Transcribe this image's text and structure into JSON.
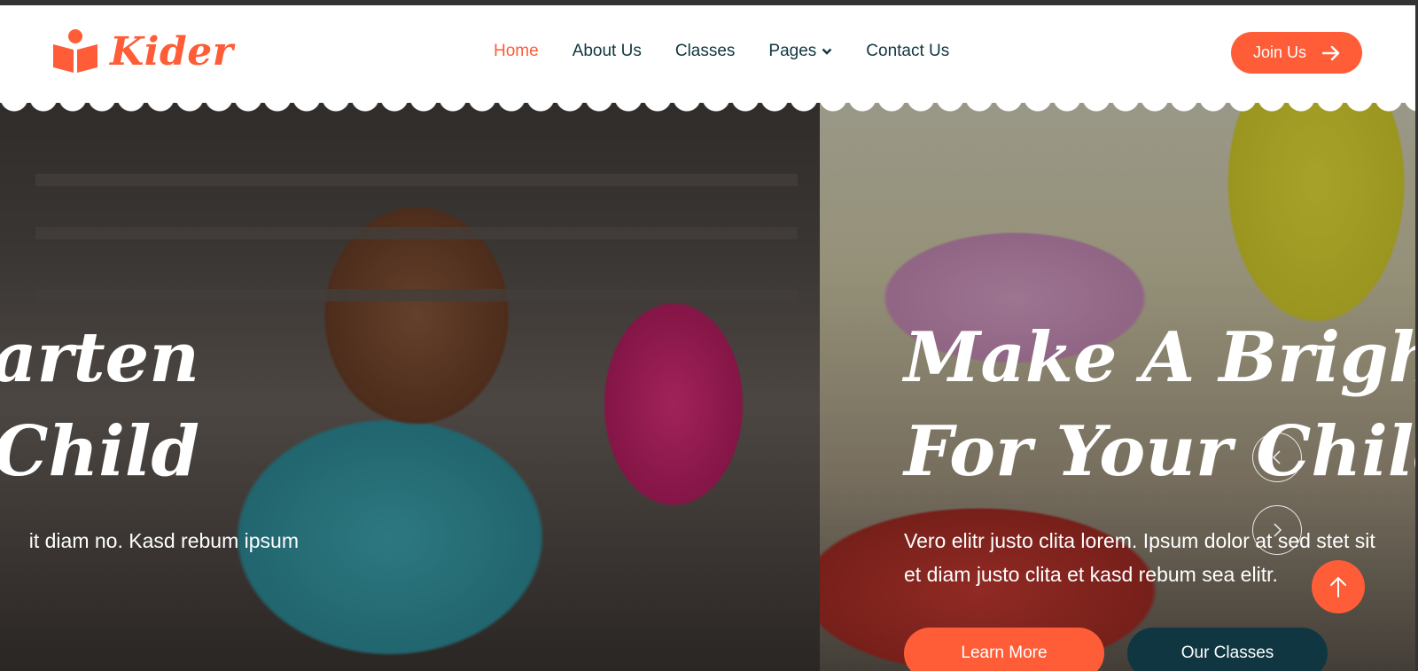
{
  "brand": {
    "name": "Kider",
    "icon": "book-reader-icon"
  },
  "nav": {
    "items": [
      {
        "label": "Home",
        "active": true
      },
      {
        "label": "About Us"
      },
      {
        "label": "Classes"
      },
      {
        "label": "Pages",
        "icon": "chevron-down-icon"
      },
      {
        "label": "Contact Us"
      }
    ]
  },
  "header": {
    "join_label": "Join Us",
    "join_icon": "arrow-right-icon"
  },
  "carousel": {
    "slide_prev": {
      "title_line1": "garten",
      "title_line2": "Child",
      "text_line1": "it diam no. Kasd rebum ipsum"
    },
    "slide_current": {
      "title_line1": "Make A Brighter",
      "title_line2": "For Your Child",
      "text_line1": "Vero elitr justo clita lorem. Ipsum dolor at sed stet sit",
      "text_line2": "et diam justo clita et kasd rebum sea elitr.",
      "learn_label": "Learn More",
      "classes_label": "Our Classes"
    },
    "controls": {
      "prev_icon": "chevron-left-icon",
      "next_icon": "chevron-right-icon"
    }
  },
  "back_to_top": {
    "icon": "arrow-up-icon"
  },
  "colors": {
    "accent": "#FE5D37",
    "dark": "#103741"
  }
}
